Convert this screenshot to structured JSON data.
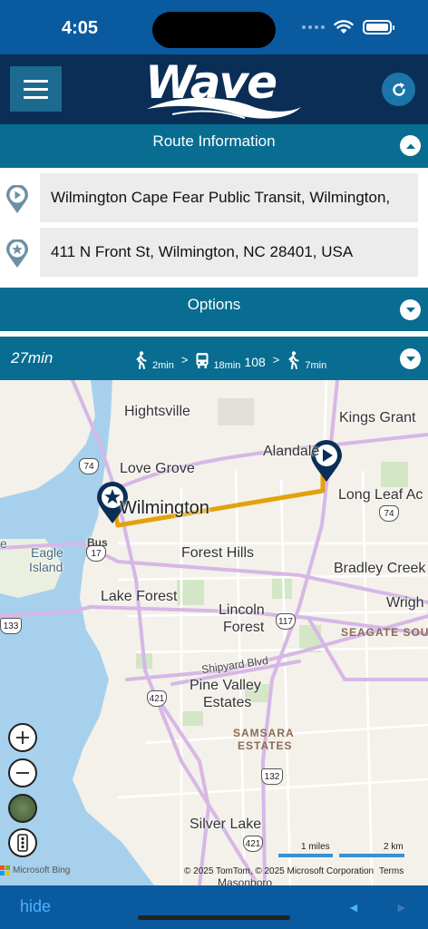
{
  "status": {
    "time": "4:05"
  },
  "header": {
    "logo": "Wave"
  },
  "route_section": {
    "label": "Route Information"
  },
  "route": {
    "origin": "Wilmington Cape Fear Public Transit, Wilmington,",
    "destination": "411 N Front St, Wilmington, NC 28401, USA"
  },
  "options_section": {
    "label": "Options"
  },
  "summary": {
    "duration": "27min",
    "walk1": "2min",
    "bus_time": "18min",
    "bus_route": "108",
    "walk2": "7min"
  },
  "map": {
    "labels": {
      "hightsville": "Hightsville",
      "kings_grant": "Kings Grant",
      "alandale": "Alandale",
      "love_grove": "Love Grove",
      "wilmington": "Wilmington",
      "long_leaf": "Long Leaf Ac",
      "bus": "Bus",
      "eagle": "Eagle",
      "island": "Island",
      "forest_hills": "Forest Hills",
      "bradley_creek": "Bradley Creek",
      "lake_forest": "Lake Forest",
      "wrigh": "Wrigh",
      "lincoln": "Lincoln",
      "forest": "Forest",
      "seagate": "SEAGATE SOU",
      "shipyard": "Shipyard Blvd",
      "pine_valley": "Pine Valley",
      "estates": "Estates",
      "samsara": "SAMSARA",
      "samsara_estates": "ESTATES",
      "silver_lake": "Silver Lake",
      "masonboro": "Masonboro",
      "e_left": "e"
    },
    "shields": {
      "s74a": "74",
      "s74b": "74",
      "s17": "17",
      "s117": "117",
      "s133": "133",
      "s421a": "421",
      "s132": "132",
      "s421b": "421"
    },
    "attribution": {
      "bing": "Microsoft Bing",
      "copyright": "© 2025 TomTom, © 2025 Microsoft Corporation",
      "terms": "Terms",
      "scale_miles": "1 miles",
      "scale_km": "2 km"
    },
    "route_color": "#e3a20b"
  },
  "bottom": {
    "hide": "hide"
  }
}
